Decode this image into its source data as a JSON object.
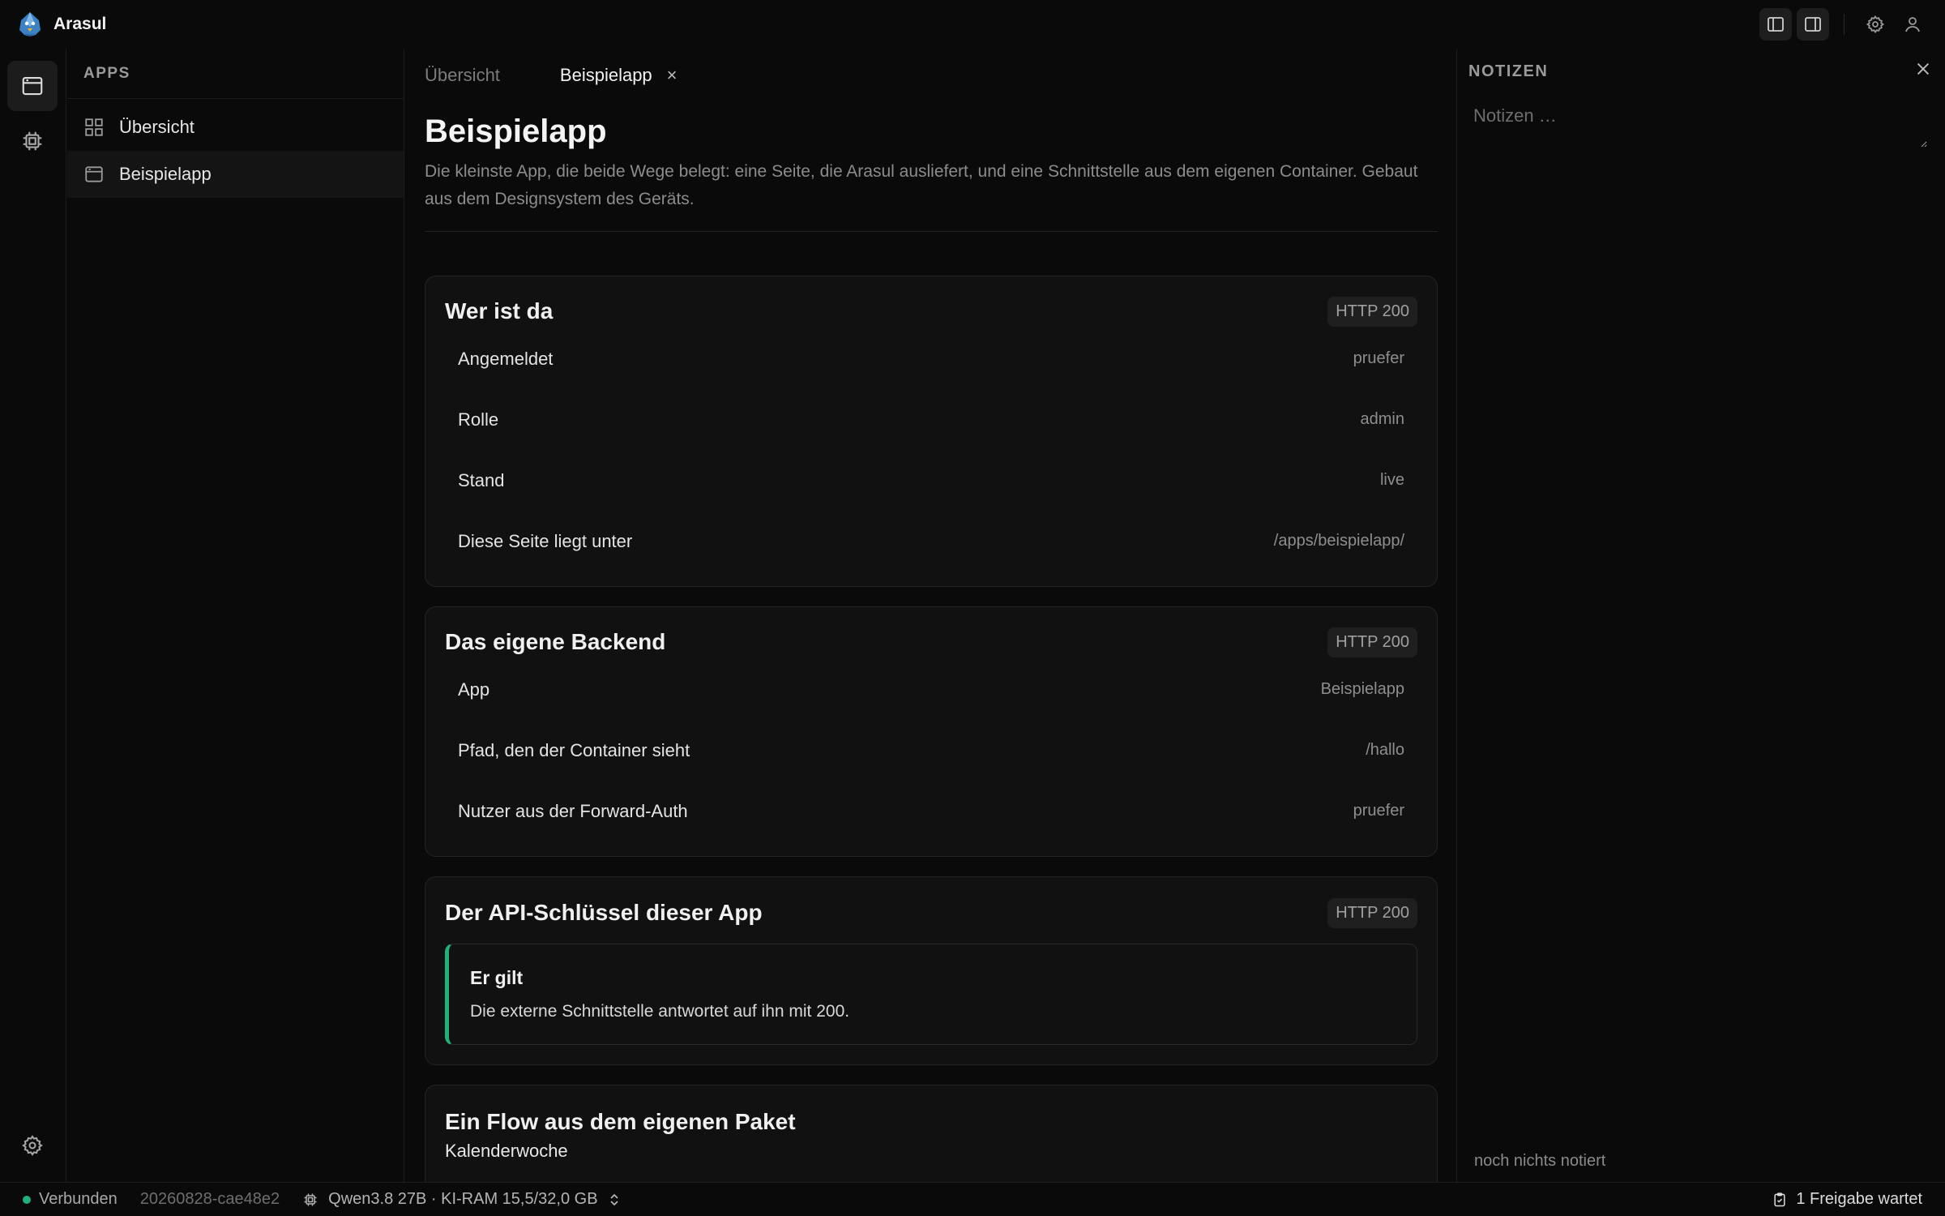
{
  "app": {
    "name": "Arasul"
  },
  "sidebar": {
    "heading": "APPS",
    "items": [
      {
        "label": "Übersicht",
        "icon": "grid-icon"
      },
      {
        "label": "Beispielapp",
        "icon": "window-icon"
      }
    ]
  },
  "tabs": [
    {
      "label": "Übersicht"
    },
    {
      "label": "Beispielapp",
      "close": "×"
    }
  ],
  "page": {
    "title": "Beispielapp",
    "subtitle": "Die kleinste App, die beide Wege belegt: eine Seite, die Arasul ausliefert, und eine Schnittstelle aus dem eigenen Container. Gebaut aus dem Designsystem des Geräts."
  },
  "cards": {
    "who": {
      "title": "Wer ist da",
      "badge": "HTTP 200",
      "rows": [
        {
          "key": "Angemeldet",
          "value": "pruefer"
        },
        {
          "key": "Rolle",
          "value": "admin"
        },
        {
          "key": "Stand",
          "value": "live"
        },
        {
          "key": "Diese Seite liegt unter",
          "value": "/apps/beispielapp/"
        }
      ]
    },
    "backend": {
      "title": "Das eigene Backend",
      "badge": "HTTP 200",
      "rows": [
        {
          "key": "App",
          "value": "Beispielapp"
        },
        {
          "key": "Pfad, den der Container sieht",
          "value": "/hallo"
        },
        {
          "key": "Nutzer aus der Forward-Auth",
          "value": "pruefer"
        }
      ]
    },
    "apikey": {
      "title": "Der API-Schlüssel dieser App",
      "badge": "HTTP 200",
      "callout_title": "Er gilt",
      "callout_text": "Die externe Schnittstelle antwortet auf ihn mit 200."
    },
    "flow": {
      "title": "Ein Flow aus dem eigenen Paket",
      "subtitle": "Kalenderwoche"
    }
  },
  "notes": {
    "title": "NOTIZEN",
    "placeholder": "Notizen …",
    "empty": "noch nichts notiert"
  },
  "status": {
    "connection": "Verbunden",
    "build": "20260828-cae48e2",
    "model": "Qwen3.8 27B · KI-RAM 15,5/32,0 GB",
    "approvals": "1 Freigabe wartet"
  },
  "colors": {
    "accent_green": "#22b07a",
    "background": "#0a0a0a",
    "card": "#111111"
  }
}
